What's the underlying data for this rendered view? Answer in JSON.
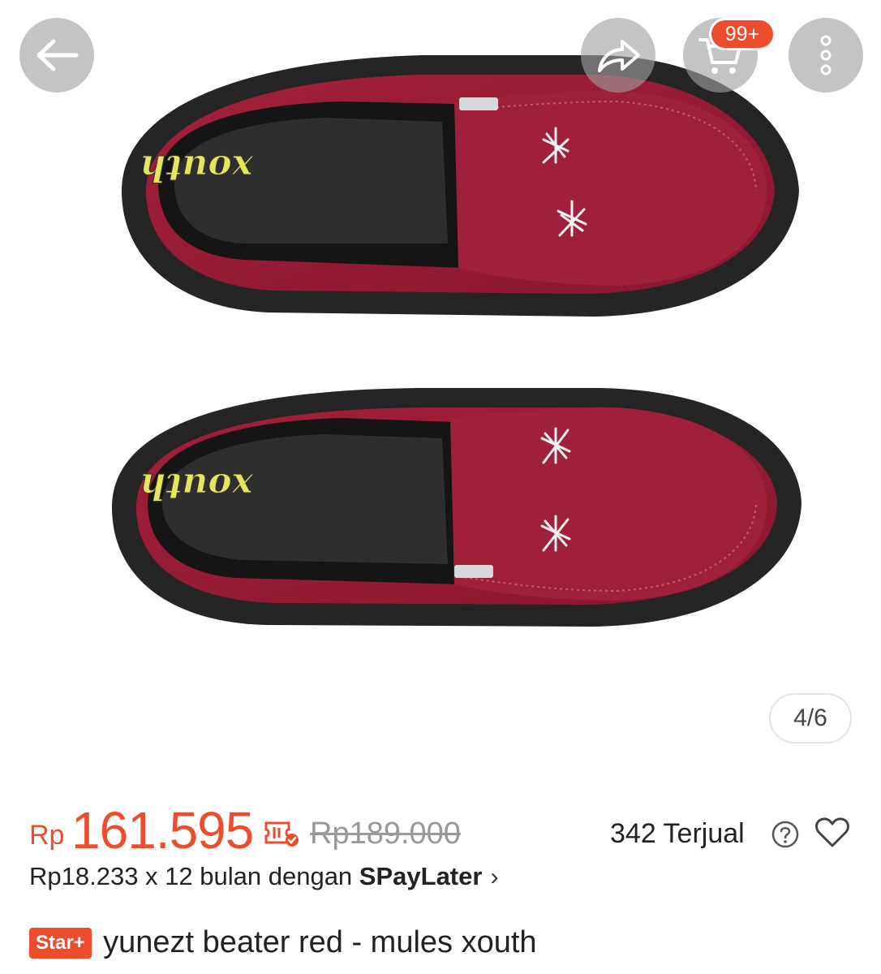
{
  "gallery": {
    "counter": "4/6",
    "brand_print": "xouth"
  },
  "header": {
    "cart_badge": "99+"
  },
  "price": {
    "currency": "Rp",
    "value": "161.595",
    "original": "Rp189.000",
    "sold": "342 Terjual"
  },
  "installment": {
    "prefix": "Rp18.233 x 12 bulan dengan ",
    "brand": "SPayLater"
  },
  "product": {
    "badge": "Star+",
    "title": "yunezt beater red - mules xouth"
  },
  "colors": {
    "accent": "#ee4d2d",
    "shoe_suede": "#9c1b35",
    "sole": "#252525"
  },
  "icons": [
    "back-arrow-icon",
    "share-icon",
    "cart-icon",
    "more-icon",
    "voucher-icon",
    "help-icon",
    "heart-icon",
    "chevron-right-icon"
  ]
}
